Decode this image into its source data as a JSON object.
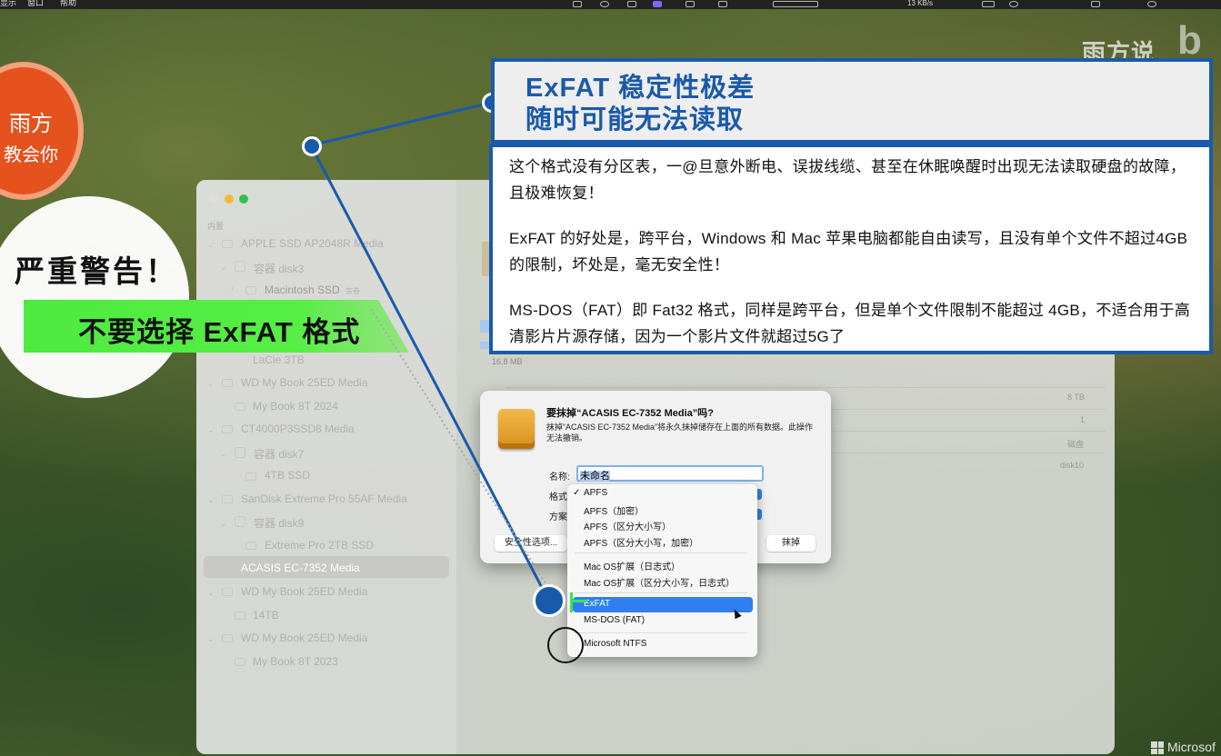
{
  "menubar": {
    "items": [
      "显示",
      "窗口",
      "帮助"
    ],
    "net_speed": "13 KB/s"
  },
  "watermark": {
    "text": "雨方说",
    "bili": "b"
  },
  "logo": {
    "line1": "雨方",
    "line2": "教会你"
  },
  "warning": {
    "title": "严重警告！",
    "banner": "不要选择 ExFAT 格式"
  },
  "sidebar": {
    "section": "内置",
    "items": [
      {
        "label": "APPLE SSD AP2048R Media"
      },
      {
        "label": "容器 disk3"
      },
      {
        "label": "Macintosh SSD",
        "badge": "宗卷"
      },
      {
        "label": "LaCie 3TB"
      },
      {
        "label": "WD My Book 25ED Media"
      },
      {
        "label": "My Book 8T 2024"
      },
      {
        "label": "CT4000P3SSD8 Media"
      },
      {
        "label": "容器 disk7"
      },
      {
        "label": "4TB SSD"
      },
      {
        "label": "SanDisk Extreme Pro 55AF Media"
      },
      {
        "label": "容器 disk9"
      },
      {
        "label": "Extreme Pro 2TB SSD"
      },
      {
        "label": "ACASIS EC-7352 Media"
      },
      {
        "label": "WD My Book 25ED Media"
      },
      {
        "label": "14TB"
      },
      {
        "label": "WD My Book 25ED Media"
      },
      {
        "label": "My Book 8T 2023"
      }
    ]
  },
  "main": {
    "size_label": "16.8 MB",
    "rows": [
      "8 TB",
      "1",
      "磁盘",
      "disk10"
    ]
  },
  "dialog": {
    "title": "要抹掉“ACASIS EC-7352 Media”吗?",
    "description": "抹掉“ACASIS EC-7352 Media”将永久抹掉储存在上面的所有数据。此操作无法撤销。",
    "name_label": "名称:",
    "name_value": "未命名",
    "format_label": "格式",
    "scheme_label": "方案",
    "security_button": "安全性选项...",
    "erase_button": "抹掉"
  },
  "format_menu": {
    "groups": [
      [
        "APFS",
        "APFS（加密）",
        "APFS（区分大小写）",
        "APFS（区分大小写，加密）"
      ],
      [
        "Mac OS扩展（日志式）",
        "Mac OS扩展（区分大小写，日志式）"
      ],
      [
        "ExFAT",
        "MS-DOS (FAT)"
      ],
      [
        "Microsoft NTFS"
      ]
    ],
    "checked": "APFS",
    "highlighted": "ExFAT"
  },
  "annotation": {
    "title_line1": "ExFAT 稳定性极差",
    "title_line2": "随时可能无法读取",
    "p1": "这个格式没有分区表，一@旦意外断电、误拔线缆、甚至在休眠唤醒时出现无法读取硬盘的故障，且极难恢复！",
    "p2": "ExFAT 的好处是，跨平台，Windows 和 Mac 苹果电脑都能自由读写，且没有单个文件不超过4GB的限制，坏处是，毫无安全性！",
    "p3": "MS-DOS（FAT）即 Fat32 格式，同样是跨平台，但是单个文件限制不能超过 4GB，不适合用于高清影片片源存储，因为一个影片文件就超过5G了"
  },
  "footer": {
    "ms_text": "Microsof"
  },
  "colors": {
    "accent_blue": "#1a5aaa",
    "green": "#4fea40",
    "orange": "#e5521e",
    "select_blue": "#2f7ff0"
  }
}
